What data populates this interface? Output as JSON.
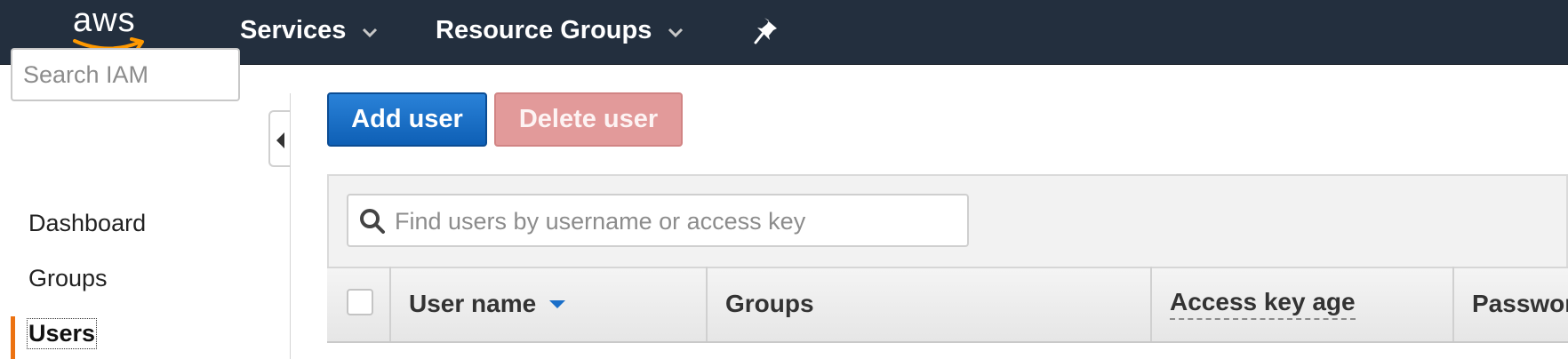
{
  "header": {
    "logo_text": "aws",
    "nav": [
      {
        "label": "Services"
      },
      {
        "label": "Resource Groups"
      }
    ]
  },
  "sidebar": {
    "search_placeholder": "Search IAM",
    "items": [
      {
        "label": "Dashboard"
      },
      {
        "label": "Groups"
      },
      {
        "label": "Users",
        "active": true
      }
    ]
  },
  "toolbar": {
    "add_user_label": "Add user",
    "delete_user_label": "Delete user"
  },
  "filter": {
    "placeholder": "Find users by username or access key"
  },
  "table": {
    "columns": [
      "User name",
      "Groups",
      "Access key age",
      "Password age"
    ],
    "sort_column": "User name"
  },
  "colors": {
    "nav_bg": "#232f3e",
    "accent": "#ec7211",
    "primary": "#1a6fc9"
  }
}
